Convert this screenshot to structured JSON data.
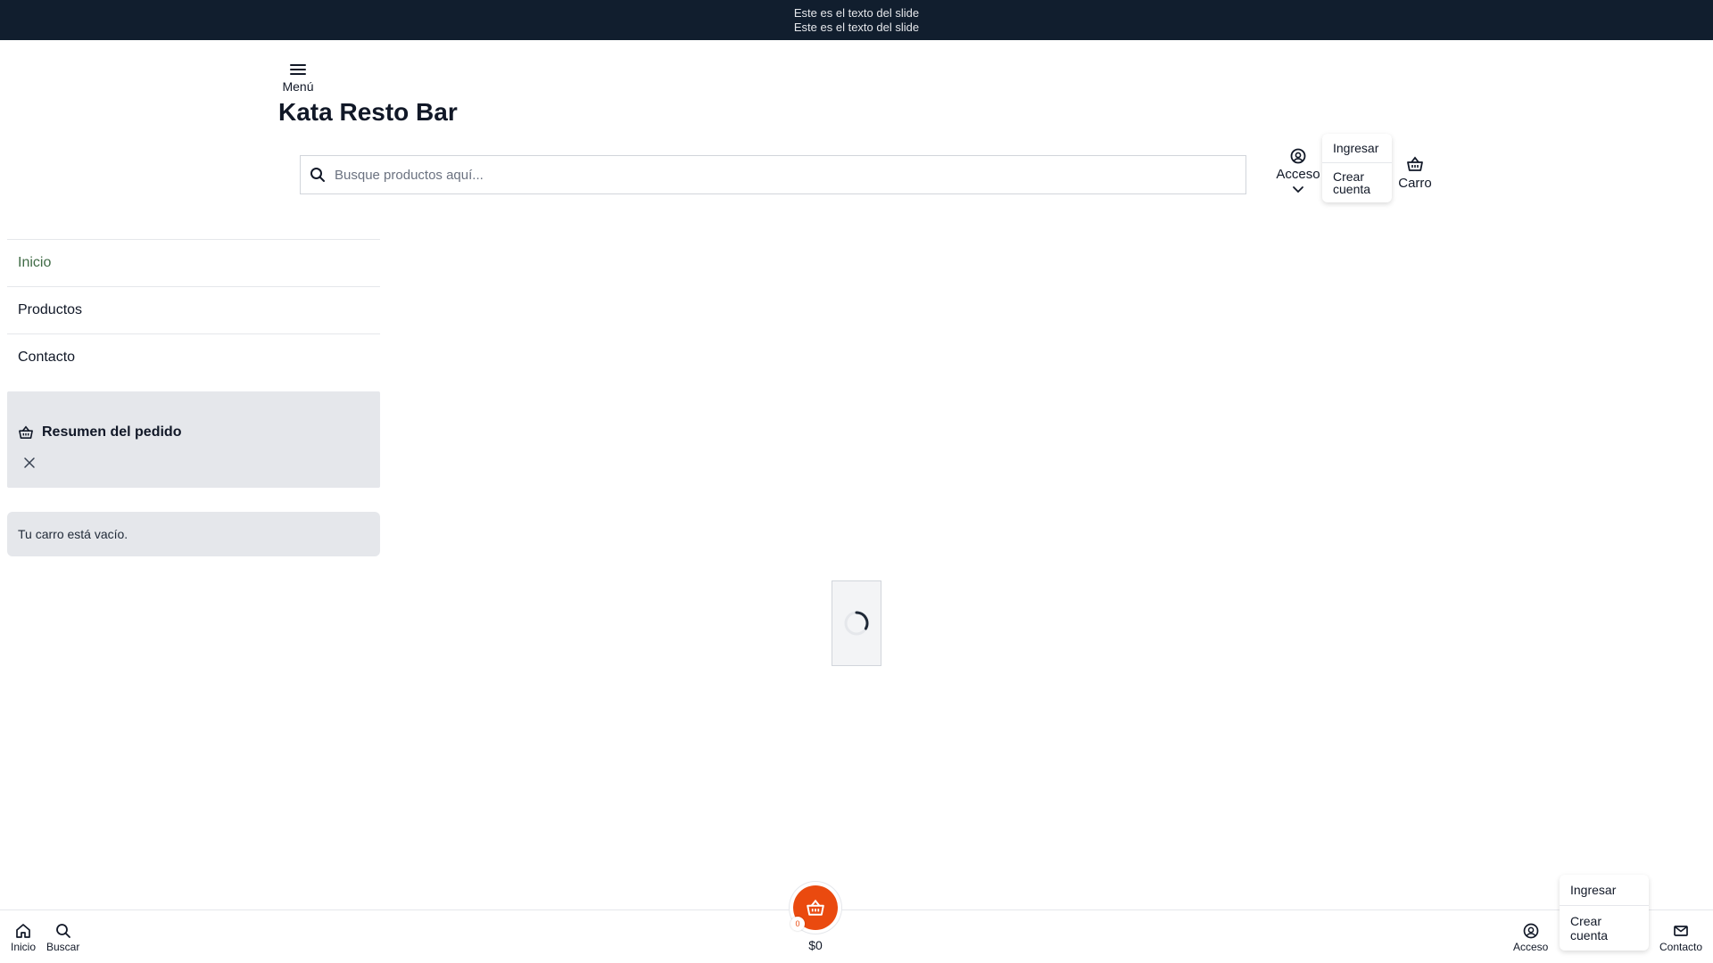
{
  "announcement": {
    "line1": "Este es el texto del slide",
    "line2": "Este es el texto del slide"
  },
  "header": {
    "menu_label": "Menú",
    "store_name": "Kata Resto Bar",
    "search_placeholder": "Busque productos aquí...",
    "access_label": "Acceso",
    "access_menu": [
      "Ingresar",
      "Crear cuenta"
    ],
    "cart_label": "Carro"
  },
  "sidebar": {
    "items": [
      {
        "label": "Inicio",
        "active": true
      },
      {
        "label": "Productos",
        "active": false
      },
      {
        "label": "Contacto",
        "active": false
      }
    ]
  },
  "order_summary": {
    "title": "Resumen del pedido",
    "empty_message": "Tu carro está vacío."
  },
  "bottom_nav": {
    "home_label": "Inicio",
    "search_label": "Buscar",
    "cart_count": "0",
    "cart_total": "$0",
    "access_label": "Acceso",
    "contact_label": "Contacto",
    "access_menu": [
      "Ingresar",
      "Crear cuenta"
    ]
  },
  "colors": {
    "topbar": "#111e2e",
    "accent": "#ea4a0f",
    "active_nav": "#3f6b45"
  },
  "icons": [
    "menu-icon",
    "search-icon",
    "user-circle-icon",
    "chevron-down-icon",
    "basket-icon",
    "close-icon",
    "home-icon",
    "mail-icon",
    "spinner-icon"
  ]
}
